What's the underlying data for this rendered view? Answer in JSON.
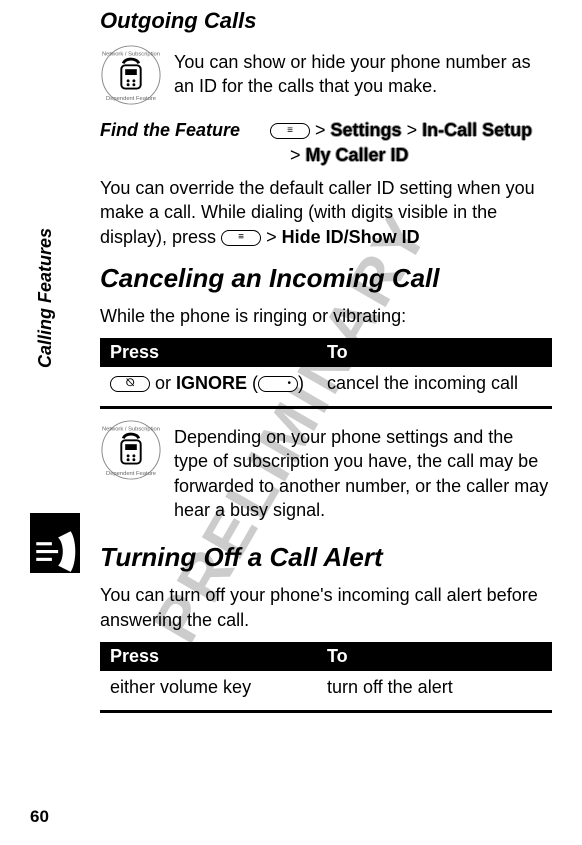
{
  "watermark": "PRELIMINARY",
  "sidebar_label": "Calling Features",
  "page_number": "60",
  "sections": {
    "outgoing": {
      "title": "Outgoing Calls",
      "intro": "You can show or hide your phone number as an ID for the calls that you make.",
      "find_feature_label": "Find the Feature",
      "path1": "Settings",
      "path2": "In-Call Setup",
      "path3": "My Caller ID",
      "override_pre": "You can override the default caller ID setting when you make a call. While dialing (with digits visible in the display), press ",
      "override_action": "Hide ID/Show ID"
    },
    "cancel": {
      "title": "Canceling an Incoming Call",
      "intro": "While the phone is ringing or vibrating:",
      "table": {
        "h1": "Press",
        "h2": "To",
        "c1_or": " or ",
        "c1_ignore": "IGNORE",
        "c2": "cancel the incoming call"
      },
      "dep_note": "Depending on your phone settings and the type of subscription you have, the call may be forwarded to another number, or the caller may hear a busy signal."
    },
    "turnoff": {
      "title": "Turning Off a Call Alert",
      "intro": "You can turn off your phone's incoming call alert before answering the call.",
      "table": {
        "h1": "Press",
        "h2": "To",
        "c1": "either volume key",
        "c2": "turn off the alert"
      }
    }
  }
}
